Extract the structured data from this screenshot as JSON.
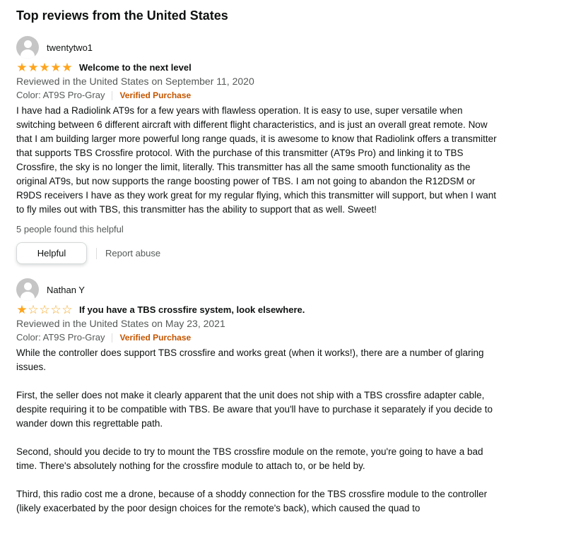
{
  "section_title": "Top reviews from the United States",
  "reviews": [
    {
      "reviewer": "twentytwo1",
      "rating": 5,
      "title": "Welcome to the next level",
      "reviewed": "Reviewed in the United States on September 11, 2020",
      "color": "Color: AT9S Pro-Gray",
      "verified": "Verified Purchase",
      "text": "I have had a Radiolink AT9s for a few years with flawless operation. It is easy to use, super versatile when switching between 6 different aircraft with different flight characteristics, and is just an overall great remote. Now that I am building larger more powerful long range quads, it is awesome to know that Radiolink offers a transmitter that supports TBS Crossfire protocol. With the purchase of this transmitter (AT9s Pro) and linking it to TBS Crossfire, the sky is no longer the limit, literally. This transmitter has all the same smooth functionality as the original AT9s, but now supports the range boosting power of TBS. I am not going to abandon the R12DSM or R9DS receivers I have as they work great for my regular flying, which this transmitter will support, but when I want to fly miles out with TBS, this transmitter has the ability to support that as well. Sweet!",
      "helpful_count": "5 people found this helpful",
      "helpful_label": "Helpful",
      "report_label": "Report abuse"
    },
    {
      "reviewer": "Nathan Y",
      "rating": 1,
      "title": "If you have a TBS crossfire system, look elsewhere.",
      "reviewed": "Reviewed in the United States on May 23, 2021",
      "color": "Color: AT9S Pro-Gray",
      "verified": "Verified Purchase",
      "text": "While the controller does support TBS crossfire and works great (when it works!), there are a number of glaring issues.\n\nFirst, the seller does not make it clearly apparent that the unit does not ship with a TBS crossfire adapter cable, despite requiring it to be compatible with TBS. Be aware that you'll have to purchase it separately if you decide to wander down this regrettable path.\n\nSecond, should you decide to try to mount the TBS crossfire module on the remote, you're going to have a bad time. There's absolutely nothing for the crossfire module to attach to, or be held by.\n\nThird, this radio cost me a drone, because of a shoddy connection for the TBS crossfire module to the controller (likely exacerbated by the poor design choices for the remote's back), which caused the quad to"
    }
  ],
  "colors": {
    "star": "#ffa41c",
    "verified": "#c45500",
    "muted": "#565959"
  }
}
